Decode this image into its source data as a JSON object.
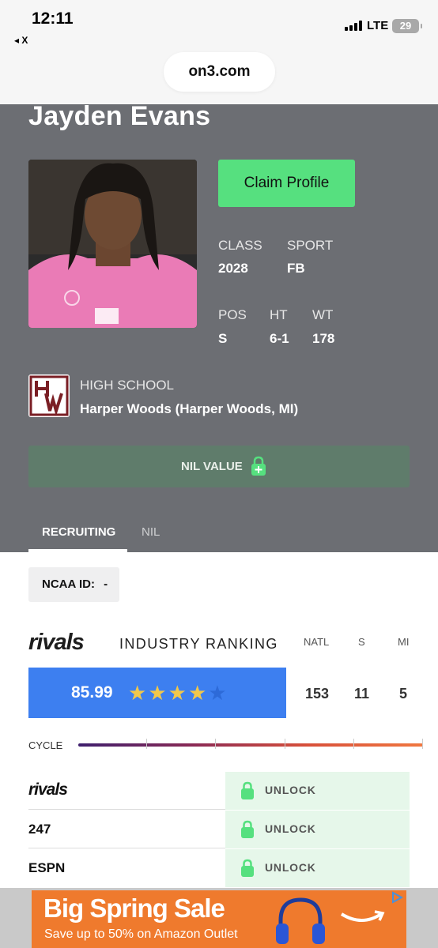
{
  "status_bar": {
    "time": "12:11",
    "back_app": "◂ X",
    "network": "LTE",
    "battery": "29"
  },
  "browser": {
    "url": "on3.com"
  },
  "player": {
    "name": "Jayden Evans",
    "claim_label": "Claim Profile",
    "class_label": "CLASS",
    "class_value": "2028",
    "sport_label": "SPORT",
    "sport_value": "FB",
    "pos_label": "POS",
    "pos_value": "S",
    "ht_label": "HT",
    "ht_value": "6-1",
    "wt_label": "WT",
    "wt_value": "178",
    "school_label": "HIGH SCHOOL",
    "school_name": "Harper Woods (Harper Woods, MI)",
    "nil_label": "NIL VALUE"
  },
  "tabs": [
    {
      "label": "RECRUITING",
      "active": true
    },
    {
      "label": "NIL",
      "active": false
    }
  ],
  "ncaa": {
    "label": "NCAA ID:",
    "value": "-"
  },
  "ranking": {
    "brand": "rivals",
    "title": "INDUSTRY RANKING",
    "col_natl": "NATL",
    "col_s": "S",
    "col_mi": "MI",
    "rating": "85.99",
    "stars_filled": 4,
    "stars_total": 5,
    "natl_value": "153",
    "s_value": "11",
    "mi_value": "5",
    "cycle_label": "CYCLE"
  },
  "services": [
    {
      "name": "rivals",
      "action": "UNLOCK"
    },
    {
      "name": "247",
      "action": "UNLOCK"
    },
    {
      "name": "ESPN",
      "action": "UNLOCK"
    }
  ],
  "ad": {
    "title": "Big Spring Sale",
    "subtitle": "Save up to 50% on Amazon Outlet",
    "choices_icon": "adchoices-icon"
  },
  "colors": {
    "profile_bg": "#6c6e73",
    "accent_green": "#56e07f",
    "rating_blue": "#3d7ff0",
    "star_gold": "#f1c84c",
    "ad_orange": "#ef7a2d"
  }
}
